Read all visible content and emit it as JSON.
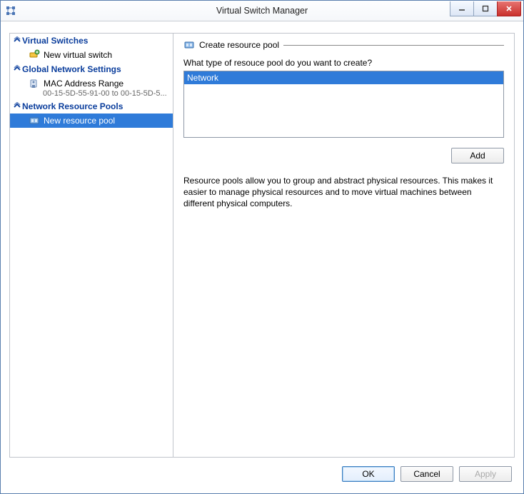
{
  "window": {
    "title": "Virtual Switch Manager"
  },
  "winControls": {
    "min": "—",
    "max": "☐",
    "close": "✕"
  },
  "sidebar": {
    "cat1": {
      "label": "Virtual Switches"
    },
    "item1": {
      "label": "New virtual switch"
    },
    "cat2": {
      "label": "Global Network Settings"
    },
    "item2": {
      "label": "MAC Address Range",
      "sub": "00-15-5D-55-91-00 to 00-15-5D-5..."
    },
    "cat3": {
      "label": "Network Resource Pools"
    },
    "item3": {
      "label": "New resource pool"
    }
  },
  "content": {
    "groupTitle": "Create resource pool",
    "question": "What type of resouce pool do you want to create?",
    "listItems": [
      "Network"
    ],
    "addLabel": "Add",
    "description": "Resource pools allow you to group and abstract physical resources. This makes it easier to manage physical resources and to move virtual machines between different physical computers."
  },
  "footer": {
    "ok": "OK",
    "cancel": "Cancel",
    "apply": "Apply"
  }
}
